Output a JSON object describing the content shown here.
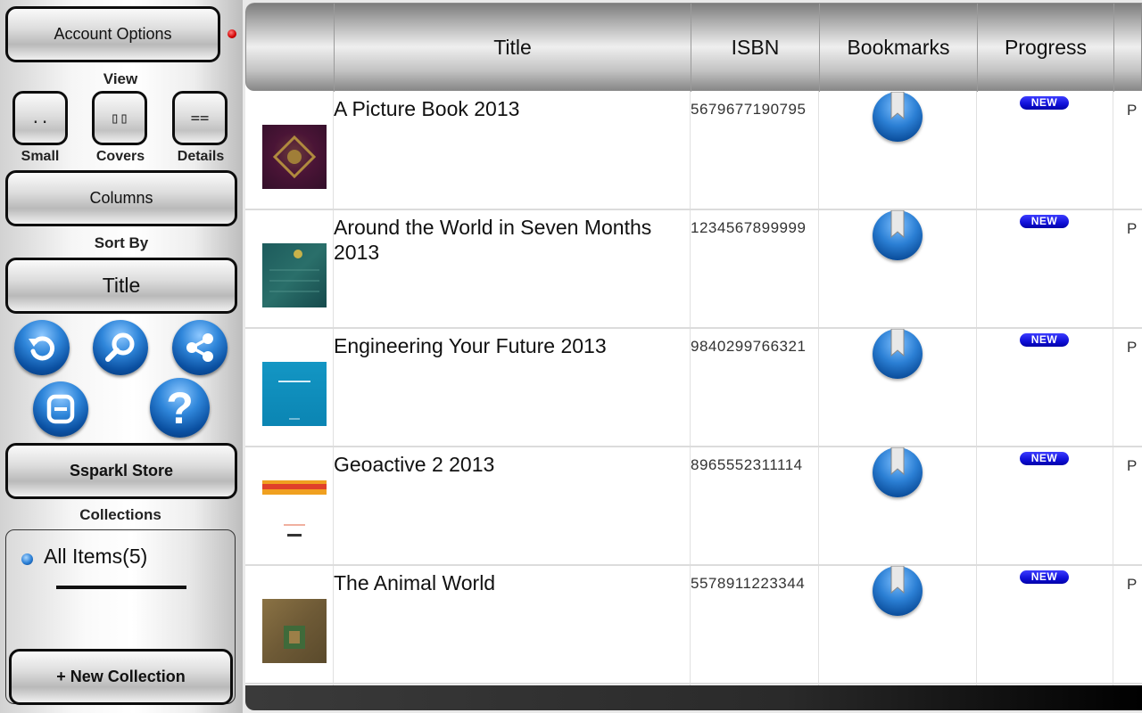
{
  "sidebar": {
    "account_options": "Account Options",
    "view_caption": "View",
    "view_buttons": [
      {
        "glyph": "..",
        "label": "Small"
      },
      {
        "glyph": "▯▯",
        "label": "Covers"
      },
      {
        "glyph": "==",
        "label": "Details"
      }
    ],
    "columns": "Columns",
    "sort_by_caption": "Sort By",
    "sort_value": "Title",
    "icons": [
      "refresh-icon",
      "search-icon",
      "share-icon",
      "blog-icon",
      "help-icon"
    ],
    "store": "Ssparkl Store",
    "collections_caption": "Collections",
    "collections": [
      {
        "label": "All Items(5)"
      }
    ],
    "new_collection": "+ New Collection",
    "notification_color": "#d00000"
  },
  "table": {
    "headers": {
      "cover": "",
      "title": "Title",
      "isbn": "ISBN",
      "bookmarks": "Bookmarks",
      "progress": "Progress"
    },
    "rows": [
      {
        "title": "A Picture Book 2013",
        "isbn": "5679677190795",
        "progress": "NEW",
        "cut": "P"
      },
      {
        "title": "Around the World in Seven Months 2013",
        "isbn": "1234567899999",
        "progress": "NEW",
        "cut": "P"
      },
      {
        "title": "Engineering Your Future 2013",
        "isbn": "9840299766321",
        "progress": "NEW",
        "cut": "P"
      },
      {
        "title": "Geoactive 2 2013",
        "isbn": "8965552311114",
        "progress": "NEW",
        "cut": "P"
      },
      {
        "title": "The Animal World",
        "isbn": "5578911223344",
        "progress": "NEW",
        "cut": "P"
      }
    ]
  },
  "colors": {
    "accent_blue": "#1f6fc4",
    "badge_blue": "#1010d8"
  }
}
